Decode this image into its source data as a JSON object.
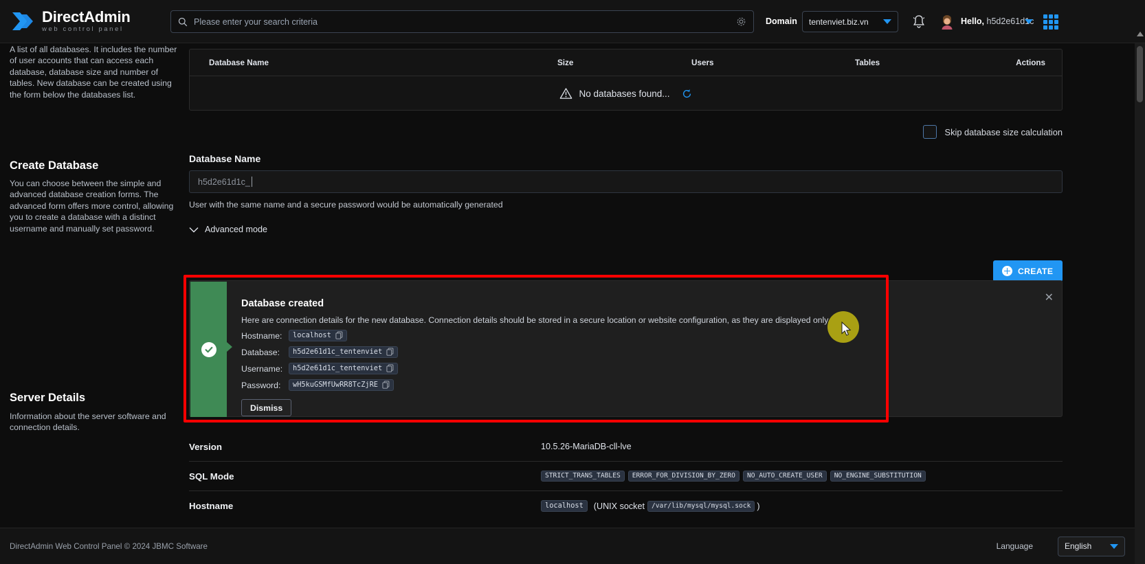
{
  "header": {
    "brand_title_1": "Direct",
    "brand_title_2": "Admin",
    "brand_subtitle": "web control panel",
    "search_placeholder": "Please enter your search criteria",
    "search_value": "",
    "search_icon": "search-icon",
    "settings_icon": "gear-icon",
    "domain_label": "Domain",
    "domain_value": "tentenviet.biz.vn",
    "bell_icon": "bell-notification-icon",
    "avatar_icon": "user-avatar-icon",
    "greeting_prefix": "Hello,",
    "greeting_user": "h5d2e61d1c",
    "apps_icon": "grid-apps-icon",
    "accent_color": "#2196f3"
  },
  "sidebar": {
    "databases_description": "A list of all databases. It includes the number of user accounts that can access each database, database size and number of tables. New database can be created using the form below the databases list.",
    "create_database_heading": "Create Database",
    "create_database_description": "You can choose between the simple and advanced database creation forms. The advanced form offers more control, allowing you to create a database with a distinct username and manually set password.",
    "server_details_heading": "Server Details",
    "server_details_description": "Information about the server software and connection details."
  },
  "databases_table": {
    "columns": [
      "Database Name",
      "Size",
      "Users",
      "Tables",
      "Actions"
    ],
    "empty_message": "No databases found...",
    "empty_icon": "warning-triangle-icon",
    "refresh_icon": "refresh-icon",
    "rows": []
  },
  "skip_option": {
    "label": "Skip database size calculation",
    "checked": false
  },
  "create_form": {
    "field_label": "Database Name",
    "input_value": "h5d2e61d1c_",
    "input_placeholder": "",
    "hint": "User with the same name and a secure password would be automatically generated",
    "advanced_mode_label": "Advanced mode",
    "advanced_mode_icon": "chevron-down-icon",
    "create_button_label": "CREATE",
    "create_button_icon": "plus-circle-icon"
  },
  "alert": {
    "status_icon": "check-circle-icon",
    "status_color": "#3f8a55",
    "title": "Database created",
    "description": "Here are connection details for the new database. Connection details should be stored in a secure location or website configuration, as they are displayed only once.",
    "details": [
      {
        "key": "Hostname:",
        "value": "localhost",
        "copy_icon": "copy-icon"
      },
      {
        "key": "Database:",
        "value": "h5d2e61d1c_tentenviet",
        "copy_icon": "copy-icon"
      },
      {
        "key": "Username:",
        "value": "h5d2e61d1c_tentenviet",
        "copy_icon": "copy-icon"
      },
      {
        "key": "Password:",
        "value": "wH5kuGSMfUwRR8TcZjRE",
        "copy_icon": "copy-icon"
      }
    ],
    "dismiss_label": "Dismiss",
    "close_icon": "close-icon",
    "highlight_color": "#ff0000"
  },
  "server_details": {
    "rows": [
      {
        "key": "Version",
        "value": "10.5.26-MariaDB-cll-lve"
      }
    ],
    "sql_mode_key": "SQL Mode",
    "sql_mode_chips": [
      "STRICT_TRANS_TABLES",
      "ERROR_FOR_DIVISION_BY_ZERO",
      "NO_AUTO_CREATE_USER",
      "NO_ENGINE_SUBSTITUTION"
    ],
    "hostname_key": "Hostname",
    "hostname_value": "localhost",
    "hostname_socket_prefix": "(UNIX socket",
    "hostname_socket": "/var/lib/mysql/mysql.sock",
    "hostname_socket_suffix": ")"
  },
  "footer": {
    "copyright": "DirectAdmin Web Control Panel © 2024 JBMC Software",
    "language_label": "Language",
    "language_value": "English"
  }
}
